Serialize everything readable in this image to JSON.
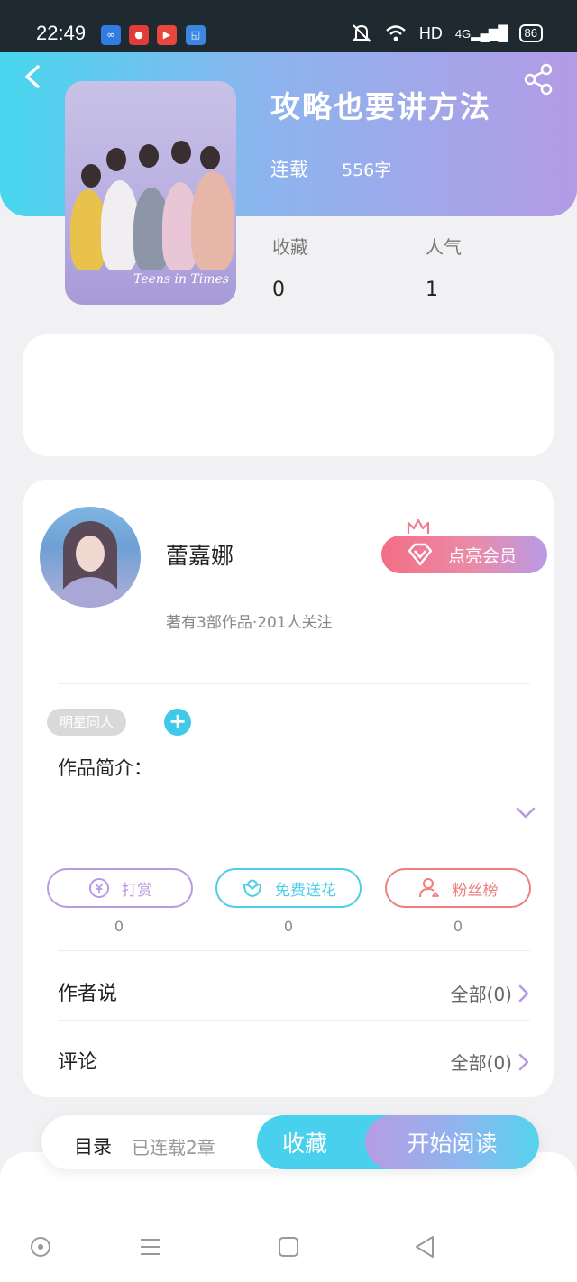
{
  "status_bar": {
    "time": "22:49",
    "network": "HD",
    "signal": "4G",
    "battery": "86"
  },
  "header": {
    "back_icon": "back-arrow-icon",
    "share_icon": "share-icon",
    "cover_caption": "Teens in Times",
    "title": "攻略也要讲方法",
    "status": "连载",
    "word_count": "556字",
    "stats": [
      {
        "label": "收藏",
        "value": "0"
      },
      {
        "label": "人气",
        "value": "1"
      }
    ]
  },
  "author": {
    "name": "蕾嘉娜",
    "meta": "著有3部作品·201人关注",
    "vip_label": "点亮会员"
  },
  "tags": [
    "明星同人"
  ],
  "add_tag_symbol": "+",
  "intro_label": "作品简介：",
  "actions": [
    {
      "label": "打赏",
      "count": "0",
      "icon": "yuan-coin-icon",
      "color": "#b79ae0"
    },
    {
      "label": "免费送花",
      "count": "0",
      "icon": "flower-icon",
      "color": "#4dcde8"
    },
    {
      "label": "粉丝榜",
      "count": "0",
      "icon": "fan-user-icon",
      "color": "#ee7f7f"
    }
  ],
  "rows": [
    {
      "label": "作者说",
      "value": "全部(0)"
    },
    {
      "label": "评论",
      "value": "全部(0)"
    }
  ],
  "bottom_bar": {
    "toc_label": "目录",
    "toc_sub": "已连载2章",
    "favorite_label": "收藏",
    "read_label": "开始阅读"
  },
  "colors": {
    "accent_cyan": "#49d0ec",
    "accent_purple": "#b79ce4",
    "accent_pink": "#f36e86"
  }
}
